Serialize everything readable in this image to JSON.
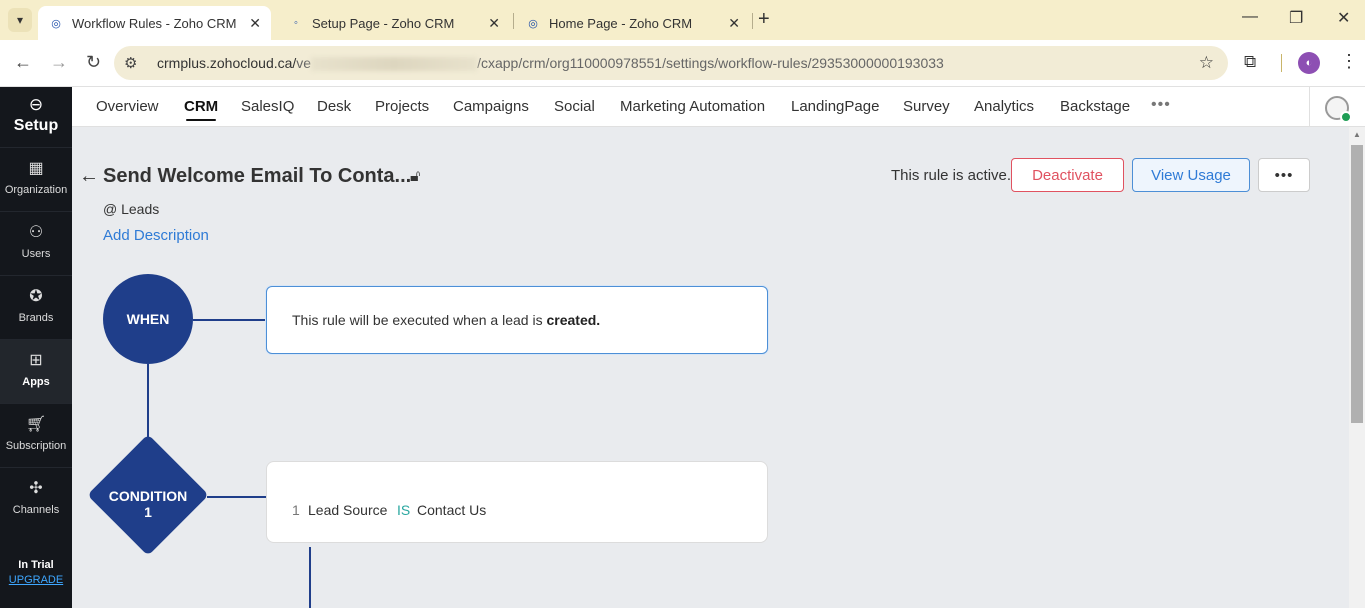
{
  "browser": {
    "tabs": [
      {
        "title": "Workflow Rules - Zoho CRM",
        "active": true
      },
      {
        "title": "Setup Page - Zoho CRM",
        "active": false
      },
      {
        "title": "Home Page - Zoho CRM",
        "active": false
      }
    ],
    "url_host": "crmplus.zohocloud.ca/",
    "url_partial": "ve",
    "url_path": "/cxapp/crm/org110000978551/settings/workflow-rules/29353000000193033",
    "icons": {
      "tab_favicon": "zoho-crm-icon",
      "close": "close-icon",
      "new_tab": "plus-icon",
      "back": "arrow-left-icon",
      "forward": "arrow-right-icon",
      "reload": "reload-icon",
      "site_info": "tune-icon",
      "bookmark": "star-icon",
      "extensions": "puzzle-icon",
      "menu": "kebab-icon"
    }
  },
  "sidebar": {
    "title": "Setup",
    "items": [
      {
        "label": "Organization",
        "icon": "building-icon"
      },
      {
        "label": "Users",
        "icon": "users-icon"
      },
      {
        "label": "Brands",
        "icon": "badge-icon"
      },
      {
        "label": "Apps",
        "icon": "apps-icon",
        "active": true
      },
      {
        "label": "Subscription",
        "icon": "cart-icon"
      },
      {
        "label": "Channels",
        "icon": "network-icon"
      }
    ],
    "trial_label": "In Trial",
    "upgrade_label": "UPGRADE"
  },
  "topnav": {
    "items": [
      "Overview",
      "CRM",
      "SalesIQ",
      "Desk",
      "Projects",
      "Campaigns",
      "Social",
      "Marketing Automation",
      "LandingPage",
      "Survey",
      "Analytics",
      "Backstage"
    ],
    "active": "CRM",
    "more": "•••"
  },
  "rule": {
    "title": "Send Welcome Email To Conta...",
    "module": "@ Leads",
    "add_description": "Add Description",
    "status_text": "This rule is active.",
    "deactivate_label": "Deactivate",
    "view_usage_label": "View Usage",
    "more_label": "•••",
    "when_label": "WHEN",
    "when_text_prefix": "This rule will be executed when a lead is ",
    "when_text_bold": "created.",
    "condition_label_line1": "CONDITION",
    "condition_label_line2": "1",
    "condition": {
      "index": "1",
      "field": "Lead Source",
      "operator": "IS",
      "value": "Contact Us"
    }
  },
  "colors": {
    "tab_bar": "#f6eecb",
    "sidebar": "#14171c",
    "flow_blue": "#1f3e8a",
    "deactivate_red": "#e05260",
    "link_blue": "#2f7bd6",
    "operator_teal": "#2aa7a0"
  }
}
